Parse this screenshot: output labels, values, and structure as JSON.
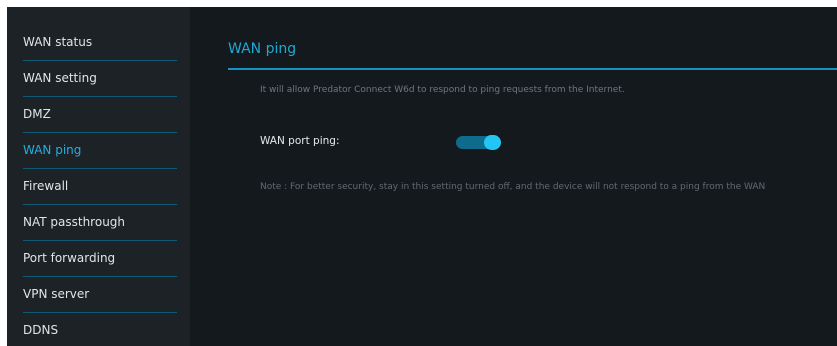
{
  "sidebar": {
    "items": [
      {
        "label": "WAN status"
      },
      {
        "label": "WAN setting"
      },
      {
        "label": "DMZ"
      },
      {
        "label": "WAN ping"
      },
      {
        "label": "Firewall"
      },
      {
        "label": "NAT passthrough"
      },
      {
        "label": "Port forwarding"
      },
      {
        "label": "VPN server"
      },
      {
        "label": "DDNS"
      }
    ],
    "active_item": "WAN ping"
  },
  "main": {
    "title": "WAN ping",
    "description": "It will allow Predator Connect W6d to respond to ping requests from the Internet.",
    "wan_port_ping": {
      "label": "WAN port ping:",
      "enabled": true
    },
    "note": "Note : For better security, stay in this setting turned off, and the device will not respond to a ping from the WAN"
  },
  "colors": {
    "accent": "#1fb0e0",
    "background": "#14191d",
    "sidebar_background": "#1d2226",
    "toggle_track": "#0f6b8c",
    "toggle_knob": "#22c6f2"
  }
}
